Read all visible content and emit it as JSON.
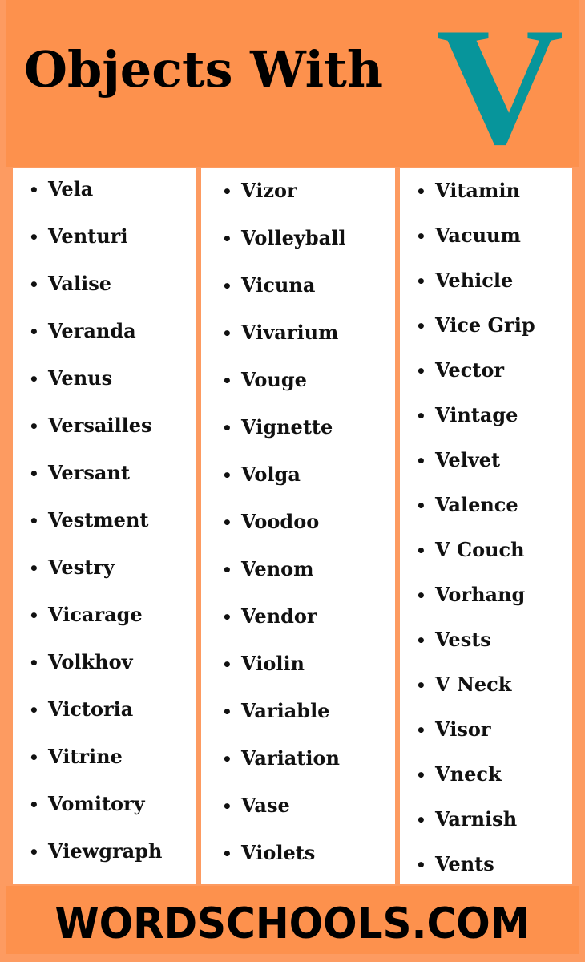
{
  "header": {
    "title": "Objects With",
    "letter": "V",
    "letter_color": "#07959b",
    "background_color": "#fd914d"
  },
  "columns": [
    {
      "items": [
        "Vela",
        "Venturi",
        "Valise",
        "Veranda",
        "Venus",
        "Versailles",
        "Versant",
        "Vestment",
        "Vestry",
        "Vicarage",
        "Volkhov",
        "Victoria",
        "Vitrine",
        "Vomitory",
        "Viewgraph"
      ]
    },
    {
      "items": [
        "Vizor",
        "Volleyball",
        "Vicuna",
        "Vivarium",
        "Vouge",
        "Vignette",
        "Volga",
        "Voodoo",
        "Venom",
        "Vendor",
        "Violin",
        "Variable",
        "Variation",
        "Vase",
        "Violets"
      ]
    },
    {
      "items": [
        "Vitamin",
        "Vacuum",
        "Vehicle",
        "Vice Grip",
        "Vector",
        "Vintage",
        "Velvet",
        "Valence",
        "V Couch",
        "Vorhang",
        "Vests",
        "V Neck",
        "Visor",
        "Vneck",
        "Varnish",
        "Vents"
      ]
    }
  ],
  "footer": {
    "text": "WORDSCHOOLS.COM"
  }
}
